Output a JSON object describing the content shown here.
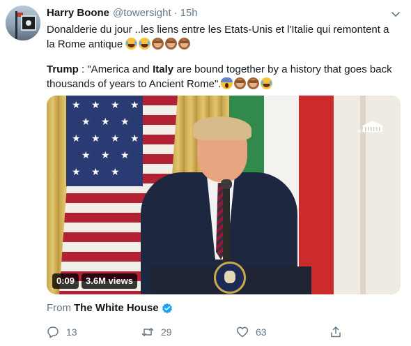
{
  "tweet": {
    "display_name": "Harry Boone",
    "handle": "@towersight",
    "separator": "·",
    "time": "15h",
    "text_line1": "Donalderie du jour ..les liens entre les Etats-Unis et l'Italie qui remontent a la Rome antique",
    "quote_speaker": "Trump",
    "quote_colon": " : ",
    "quote_part1": "\"America and ",
    "quote_bold": "Italy",
    "quote_part2": " are bound together by a history that goes back thousands of years to Ancient Rome\".",
    "emojis_line1": [
      "face-with-tears-of-joy",
      "face-with-tears-of-joy",
      "see-no-evil-monkey",
      "see-no-evil-monkey",
      "see-no-evil-monkey"
    ],
    "emojis_line2": [
      "face-screaming-in-fear",
      "see-no-evil-monkey",
      "see-no-evil-monkey",
      "face-with-tears-of-joy"
    ]
  },
  "video": {
    "duration": "0:09",
    "views": "3.6M views",
    "watermark": "WH.GOV"
  },
  "source": {
    "prefix": "From",
    "name": "The White House",
    "verified": true
  },
  "actions": {
    "replies": "13",
    "retweets": "29",
    "likes": "63"
  },
  "colors": {
    "text": "#14171a",
    "muted": "#657786",
    "verified": "#1da1f2"
  }
}
